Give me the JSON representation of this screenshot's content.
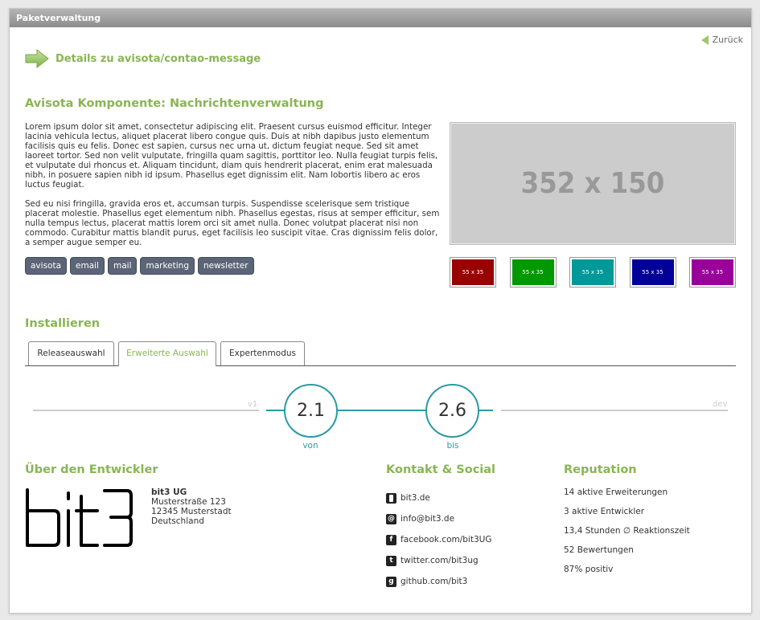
{
  "panel": {
    "title": "Paketverwaltung"
  },
  "back_label": "Zurück",
  "detail_title": "Details zu avisota/contao-message",
  "component_title": "Avisota Komponente: Nachrichtenverwaltung",
  "paragraphs": [
    "Lorem ipsum dolor sit amet, consectetur adipiscing elit. Praesent cursus euismod efficitur. Integer lacinia vehicula lectus, aliquet placerat libero congue quis. Duis at nibh dapibus justo elementum facilisis quis eu felis. Donec est sapien, cursus nec urna ut, dictum feugiat neque. Sed sit amet laoreet tortor. Sed non velit vulputate, fringilla quam sagittis, porttitor leo. Nulla feugiat turpis felis, et vulputate dui rhoncus et. Aliquam tincidunt, diam quis hendrerit placerat, enim erat malesuada nibh, in posuere sapien nibh id ipsum. Phasellus eget dignissim elit. Nam lobortis libero ac eros luctus feugiat.",
    "Sed eu nisi fringilla, gravida eros et, accumsan turpis. Suspendisse scelerisque sem tristique placerat molestie. Phasellus eget elementum nibh. Phasellus egestas, risus at semper efficitur, sem nulla tempus lectus, placerat mattis lorem orci sit amet nulla. Donec volutpat placerat nisi non commodo. Curabitur mattis blandit purus, eget facilisis leo suscipit vitae. Cras dignissim felis dolor, a semper augue semper eu."
  ],
  "tags": [
    "avisota",
    "email",
    "mail",
    "marketing",
    "newsletter"
  ],
  "main_image_label": "352 x 150",
  "thumbnails": [
    {
      "label": "55 x 35",
      "color": "#990000"
    },
    {
      "label": "55 x 35",
      "color": "#009900"
    },
    {
      "label": "55 x 35",
      "color": "#009999"
    },
    {
      "label": "55 x 35",
      "color": "#000099"
    },
    {
      "label": "55 x 35",
      "color": "#990099"
    }
  ],
  "install": {
    "title": "Installieren",
    "tabs": [
      "Releaseauswahl",
      "Erweiterte Auswahl",
      "Expertenmodus"
    ],
    "active_tab": 1,
    "range": {
      "start_label": "v1",
      "end_label": "dev",
      "from_value": "2.1",
      "from_label": "von",
      "to_value": "2.6",
      "to_label": "bis"
    }
  },
  "developer": {
    "title": "Über den Entwickler",
    "logo_text": "bit3",
    "name": "bit3 UG",
    "street": "Musterstraße 123",
    "city": "12345 Musterstadt",
    "country": "Deutschland"
  },
  "contact": {
    "title": "Kontakt & Social",
    "items": [
      {
        "icon": "bookmark-icon",
        "glyph": "",
        "label": "bit3.de"
      },
      {
        "icon": "at-icon",
        "glyph": "@",
        "label": "info@bit3.de"
      },
      {
        "icon": "facebook-icon",
        "glyph": "f",
        "label": "facebook.com/bit3UG"
      },
      {
        "icon": "twitter-icon",
        "glyph": "t",
        "label": "twitter.com/bit3ug"
      },
      {
        "icon": "github-icon",
        "glyph": "g",
        "label": "github.com/bit3"
      }
    ]
  },
  "reputation": {
    "title": "Reputation",
    "items": [
      "14 aktive Erweiterungen",
      "3 aktive Entwickler",
      "13,4 Stunden ∅ Reaktionszeit",
      "52 Bewertungen",
      "87% positiv"
    ]
  },
  "colors": {
    "accent": "#8ab552",
    "slider": "#2a9aa2",
    "tag": "#5b6577"
  }
}
